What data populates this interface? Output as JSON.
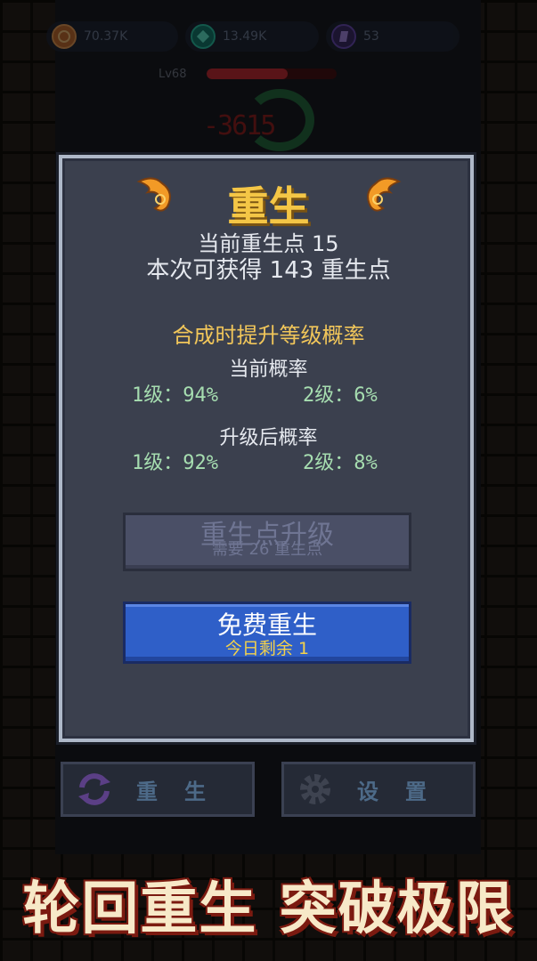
{
  "resources": [
    {
      "icon": "coin-icon",
      "value": "70.37K"
    },
    {
      "icon": "gem-icon",
      "value": "13.49K"
    },
    {
      "icon": "crystal-icon",
      "value": "53"
    }
  ],
  "enemy": {
    "level": "Lv68",
    "hp_fraction": 0.62,
    "damage_text": "-3615"
  },
  "modal": {
    "title": "重生",
    "current_points": "当前重生点 15",
    "gain_text": "本次可获得 143 重生点",
    "section_title": "合成时提升等级概率",
    "current_prob_label": "当前概率",
    "current_prob": {
      "lv1": "1级：94%",
      "lv2": "2级：6%"
    },
    "after_prob_label": "升级后概率",
    "after_prob": {
      "lv1": "1级：92%",
      "lv2": "2级：8%"
    },
    "upgrade_button": {
      "label": "重生点升级",
      "sub": "需要 26 重生点"
    },
    "free_button": {
      "label": "免费重生",
      "sub": "今日剩余 1"
    }
  },
  "bottom": {
    "rebirth_label": "重生",
    "settings_label": "设置"
  },
  "slogan": "轮回重生 突破极限",
  "colors": {
    "accent_gold": "#f4c646",
    "button_blue": "#2f5fc8",
    "panel": "#3b404e"
  }
}
